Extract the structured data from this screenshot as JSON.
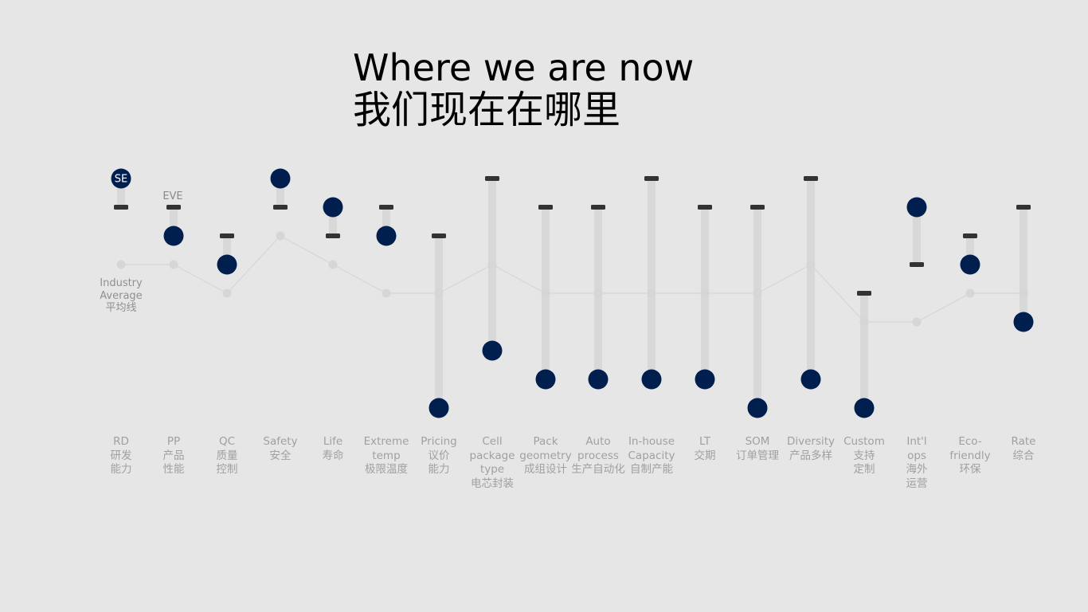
{
  "title": {
    "en": "Where we are now",
    "zh": "我们现在在哪里"
  },
  "colors": {
    "se": "#001f4f",
    "eve": "#333333",
    "avg": "#d6d6d6",
    "bar": "#d8d8d8",
    "background": "#e6e6e6"
  },
  "chart_data": {
    "type": "scatter",
    "title": "Where we are now 我们现在在哪里",
    "xlabel": "",
    "ylabel": "",
    "ylim": [
      0,
      8
    ],
    "grid": false,
    "series": [
      {
        "name": "SE",
        "marker": "filled-circle",
        "values": [
          8,
          6,
          5,
          8,
          7,
          6,
          0,
          2,
          1,
          1,
          1,
          1,
          0,
          1,
          0,
          7,
          5,
          3
        ]
      },
      {
        "name": "EVE",
        "marker": "dash",
        "values": [
          7,
          7,
          6,
          7,
          6,
          7,
          6,
          8,
          7,
          7,
          8,
          7,
          7,
          8,
          4,
          5,
          6,
          7
        ]
      },
      {
        "name": "Industry Average 平均线",
        "marker": "light-circle-line",
        "values": [
          5,
          5,
          4,
          6,
          5,
          4,
          4,
          5,
          4,
          4,
          4,
          4,
          4,
          5,
          3,
          3,
          4,
          4
        ]
      }
    ],
    "categories": [
      {
        "lines": [
          "RD",
          "研发",
          "能力"
        ]
      },
      {
        "lines": [
          "PP",
          "产品",
          "性能"
        ]
      },
      {
        "lines": [
          "QC",
          "质量",
          "控制"
        ]
      },
      {
        "lines": [
          "Safety",
          "安全"
        ]
      },
      {
        "lines": [
          "Life",
          "寿命"
        ]
      },
      {
        "lines": [
          "Extreme",
          "temp",
          "极限温度"
        ]
      },
      {
        "lines": [
          "Pricing",
          "议价",
          "能力"
        ]
      },
      {
        "lines": [
          "Cell",
          "package",
          "type",
          "电芯封装"
        ]
      },
      {
        "lines": [
          "Pack",
          "geometry",
          "成组设计"
        ]
      },
      {
        "lines": [
          "Auto",
          "process",
          "生产自动化"
        ]
      },
      {
        "lines": [
          "In-house",
          "Capacity",
          "自制产能"
        ]
      },
      {
        "lines": [
          "LT",
          "交期"
        ]
      },
      {
        "lines": [
          "SOM",
          "订单管理"
        ]
      },
      {
        "lines": [
          "Diversity",
          "产品多样"
        ]
      },
      {
        "lines": [
          "Custom",
          "支持",
          "定制"
        ]
      },
      {
        "lines": [
          "Int'l",
          "ops",
          "海外",
          "运营"
        ]
      },
      {
        "lines": [
          "Eco-",
          "friendly",
          "环保"
        ]
      },
      {
        "lines": [
          "Rate",
          "综合"
        ]
      }
    ],
    "annotations": {
      "se_label": "SE",
      "eve_label": "EVE",
      "avg_label": [
        "Industry",
        "Average",
        "平均线"
      ]
    }
  }
}
